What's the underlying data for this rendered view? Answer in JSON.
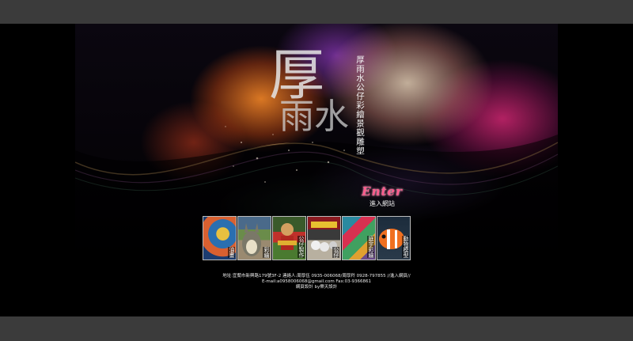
{
  "brand": {
    "logo_big": "厚",
    "logo_sub": "雨水",
    "vertical_title": "厚雨水公仔彩繪景觀雕塑"
  },
  "enter": {
    "label": "Enter",
    "sub": "進入網站"
  },
  "thumbnails": [
    {
      "caption": "油畫"
    },
    {
      "caption": "彩繪"
    },
    {
      "caption": "公仔製作"
    },
    {
      "caption": "公仔"
    },
    {
      "caption": "庭宇彩繪"
    },
    {
      "caption": "動物模型"
    }
  ],
  "footer": {
    "line1": "地址:宜蘭市新興路179號3F-2 連絡人:周厚伍 0935-006068/周厚羚 0928-797855 //進入網頁//",
    "line2": "E-mail:a0958006068@gmail.com Fax:03-9366861",
    "line3": "網頁設計 by樂天設計"
  }
}
